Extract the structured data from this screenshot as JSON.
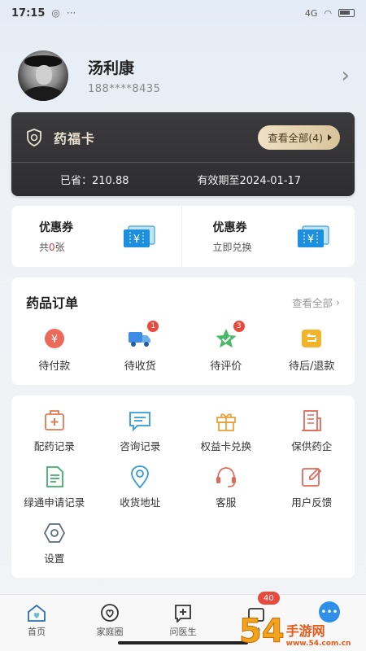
{
  "status_bar": {
    "time": "17:15",
    "network_label": "4G"
  },
  "profile": {
    "name": "汤利康",
    "phone": "188****8435"
  },
  "vip_card": {
    "title": "药福卡",
    "view_all": "查看全部(4)",
    "saved": "已省：210.88",
    "valid_until": "有效期至2024-01-17",
    "accent_color": "#d9c39b"
  },
  "coupons": [
    {
      "title": "优惠券",
      "sub_prefix": "共",
      "sub_count": "0",
      "sub_suffix": "张",
      "icon": "ticket-icon"
    },
    {
      "title": "优惠券",
      "sub_prefix": "立即兑换",
      "sub_count": "",
      "sub_suffix": "",
      "icon": "ticket-icon"
    }
  ],
  "orders": {
    "title": "药品订单",
    "view_all": "查看全部",
    "items": [
      {
        "label": "待付款",
        "icon": "yen-coin-icon",
        "badge": ""
      },
      {
        "label": "待收货",
        "icon": "delivery-truck-icon",
        "badge": "1"
      },
      {
        "label": "待评价",
        "icon": "star-check-icon",
        "badge": "3"
      },
      {
        "label": "待后/退款",
        "icon": "refund-icon",
        "badge": ""
      }
    ]
  },
  "services": [
    {
      "label": "配药记录",
      "icon": "medicine-kit-icon"
    },
    {
      "label": "咨询记录",
      "icon": "chat-record-icon"
    },
    {
      "label": "权益卡兑换",
      "icon": "gift-icon"
    },
    {
      "label": "保供药企",
      "icon": "building-icon"
    },
    {
      "label": "绿通申请记录",
      "icon": "document-icon"
    },
    {
      "label": "收货地址",
      "icon": "location-pin-icon"
    },
    {
      "label": "客服",
      "icon": "headset-icon"
    },
    {
      "label": "用户反馈",
      "icon": "edit-feedback-icon"
    },
    {
      "label": "设置",
      "icon": "settings-hex-icon"
    }
  ],
  "tab_bar": [
    {
      "label": "首页",
      "icon": "home-heart-icon"
    },
    {
      "label": "家庭圈",
      "icon": "heart-circle-icon"
    },
    {
      "label": "问医生",
      "icon": "plus-chat-icon"
    },
    {
      "label": "常",
      "icon": "medicine-bag-icon",
      "badge": "40"
    },
    {
      "label": "",
      "icon": "chat-bubble-icon"
    }
  ],
  "watermark": {
    "big": "54",
    "cn": "手游网",
    "url": "www.54.com.cn"
  }
}
